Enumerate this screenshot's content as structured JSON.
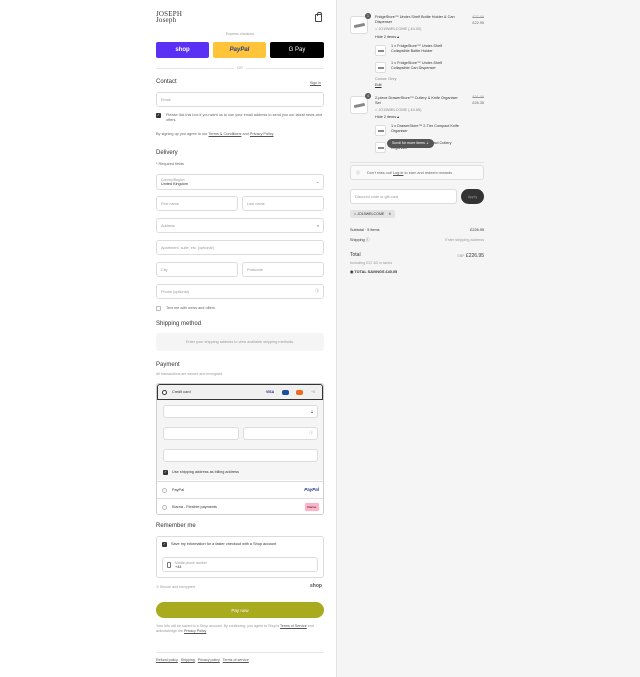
{
  "brand": {
    "logo_line1": "JOSEPH",
    "logo_line2": "Joseph"
  },
  "express": {
    "label": "Express checkout",
    "shop": "shop",
    "paypal": "PayPal",
    "gpay": "G Pay",
    "or": "OR"
  },
  "contact": {
    "title": "Contact",
    "signin": "Sign in",
    "email_placeholder": "Email",
    "news_label": "Please tick this box if you want us to use your email address to send you our latest news and offers.",
    "terms_text": "By signing up you agree to our",
    "terms_link": "Terms & Conditions",
    "and": "and",
    "privacy_link": "Privacy Policy"
  },
  "delivery": {
    "title": "Delivery",
    "required": "* Required fields",
    "country_label": "Country/Region",
    "country_value": "United Kingdom",
    "first_name": "First name",
    "last_name": "Last name",
    "address": "Address",
    "apartment": "Apartment, suite, etc. (optional)",
    "city": "City",
    "postcode": "Postcode",
    "phone": "Phone (optional)",
    "text_me": "Text me with news and offers"
  },
  "shipping": {
    "title": "Shipping method",
    "notice": "Enter your shipping address to view available shipping methods."
  },
  "payment": {
    "title": "Payment",
    "subtitle": "All transactions are secure and encrypted.",
    "card_label": "Credit card",
    "more_cards": "+5",
    "visa": "VISA",
    "billing_same": "Use shipping address as billing address",
    "paypal": "PayPal",
    "paypal_logo": "PayPal",
    "klarna": "Klarna - Flexible payments",
    "klarna_logo": "Klarna."
  },
  "remember": {
    "title": "Remember me",
    "save_label": "Save my information for a faster checkout with a Shop account",
    "mobile_label": "Mobile phone number",
    "mobile_value": "+44",
    "secure": "Secure and encrypted",
    "shop": "shop"
  },
  "pay_now": "Pay now",
  "disclaimer": {
    "text": "Your info will be saved to a Shop account. By continuing, you agree to Shop's",
    "tos": "Terms of Service",
    "ack": "and acknowledge the",
    "privacy": "Privacy Policy"
  },
  "footer": {
    "refund": "Refund policy",
    "shipping": "Shipping",
    "privacy": "Privacy policy",
    "terms": "Terms of service"
  },
  "cart": {
    "items": [
      {
        "qty": "1",
        "title": "FridgeStore™ Under-Shelf Bottle Holder & Can Dispenser",
        "discount": "JO15WELCOME (-£4.00)",
        "orig": "£27.00",
        "price": "£22.95",
        "toggle": "Hide 2 items ▴",
        "subs": [
          {
            "qty": "1 x",
            "name": "FridgeStore™ Under-Shelf Collapsible Bottle Holder"
          },
          {
            "qty": "1 x",
            "name": "FridgeStore™ Under-Shelf Collapsible Can Dispenser"
          }
        ],
        "colour": "Colour: Grey",
        "edit": "Edit"
      },
      {
        "qty": "4",
        "title": "2-piece DrawerStore™ Cutlery & Knife Organiser Set",
        "discount": "JO15WELCOME (-£4.65)",
        "orig": "£31.00",
        "price": "£26.35",
        "toggle": "Hide 2 items ▴",
        "subs": [
          {
            "qty": "1 x",
            "name": "DrawerStore™ 2-Tier Compact Knife Organiser"
          },
          {
            "qty": "1 x",
            "name": "DrawerStore™ Compact Cutlery Organiser"
          }
        ]
      }
    ],
    "scroll_hint": "Scroll for more items ⇣",
    "rewards": {
      "prefix": "Don't miss out!",
      "link": "Log in",
      "suffix": "to earn and redeem rewards"
    },
    "discount_placeholder": "Discount code or gift card",
    "apply": "Apply",
    "code_tag": "JO15WELCOME",
    "subtotal_label": "Subtotal · 5 items",
    "subtotal_value": "£226.95",
    "shipping_label": "Shipping",
    "shipping_value": "Enter shipping address",
    "total_label": "Total",
    "total_currency": "GBP",
    "total_value": "£226.95",
    "tax": "Including £37.83 in taxes",
    "savings": "TOTAL SAVINGS £40.05"
  },
  "colors": {
    "shop": "#5a31f4",
    "paypal": "#ffc439",
    "pay_now": "#a9ab1f",
    "klarna": "#ffb3c7"
  }
}
